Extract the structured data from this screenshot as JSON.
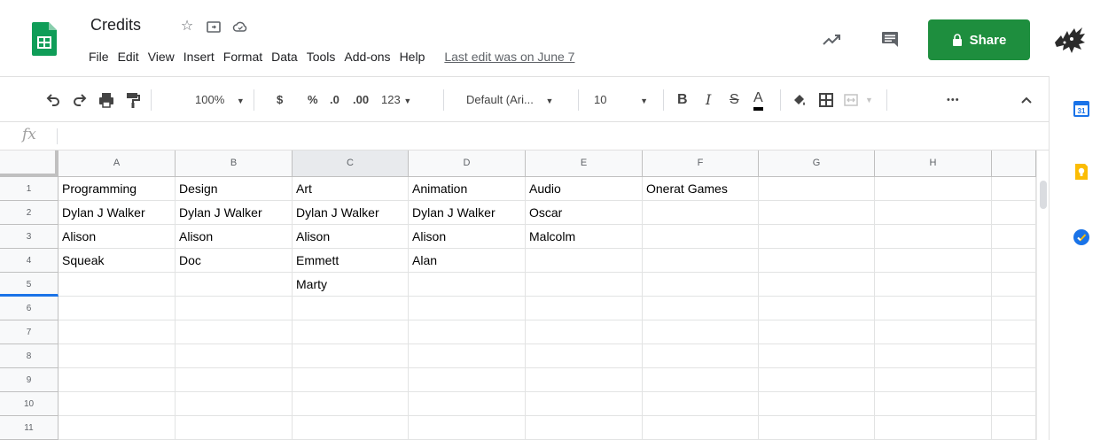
{
  "doc": {
    "title": "Credits",
    "last_edit": "Last edit was on June 7"
  },
  "menu": [
    "File",
    "Edit",
    "View",
    "Insert",
    "Format",
    "Data",
    "Tools",
    "Add-ons",
    "Help"
  ],
  "share": {
    "label": "Share"
  },
  "toolbar": {
    "zoom": "100%",
    "currency": "$",
    "percent": "%",
    "dec_decrease": ".0",
    "dec_increase": ".00",
    "more_formats": "123",
    "font": "Default (Ari...",
    "font_size": "10",
    "bold": "B",
    "italic": "I",
    "strike": "S",
    "text_color": "A",
    "more": "•••"
  },
  "formula": {
    "fx": "fx",
    "value": ""
  },
  "columns": [
    "A",
    "B",
    "C",
    "D",
    "E",
    "F",
    "G",
    "H"
  ],
  "rows": [
    [
      "Programming",
      "Design",
      "Art",
      "Animation",
      "Audio",
      "Onerat Games",
      "",
      ""
    ],
    [
      "Dylan J Walker",
      "Dylan J Walker",
      "Dylan J Walker",
      "Dylan J Walker",
      "Oscar",
      "",
      "",
      ""
    ],
    [
      "Alison",
      "Alison",
      "Alison",
      "Alison",
      "Malcolm",
      "",
      "",
      ""
    ],
    [
      "Squeak",
      "Doc",
      "Emmett",
      "Alan",
      "",
      "",
      "",
      ""
    ],
    [
      "",
      "",
      "Marty",
      "",
      "",
      "",
      "",
      ""
    ],
    [
      "",
      "",
      "",
      "",
      "",
      "",
      "",
      ""
    ],
    [
      "",
      "",
      "",
      "",
      "",
      "",
      "",
      ""
    ],
    [
      "",
      "",
      "",
      "",
      "",
      "",
      "",
      ""
    ],
    [
      "",
      "",
      "",
      "",
      "",
      "",
      "",
      ""
    ],
    [
      "",
      "",
      "",
      "",
      "",
      "",
      "",
      ""
    ],
    [
      "",
      "",
      "",
      "",
      "",
      "",
      "",
      ""
    ]
  ],
  "row_numbers": [
    "1",
    "2",
    "3",
    "4",
    "5",
    "6",
    "7",
    "8",
    "9",
    "10",
    "11"
  ],
  "side_panel": {
    "calendar_day": "31"
  },
  "colors": {
    "share_green": "#1e8e3e",
    "sheets_green": "#0f9d58",
    "selection_blue": "#1a73e8",
    "keep_yellow": "#fbbc04",
    "tasks_blue": "#1a73e8"
  },
  "icons": [
    "sheets-logo-icon",
    "star-icon",
    "move-folder-icon",
    "cloud-status-icon",
    "trend-icon",
    "comment-icon",
    "lock-icon",
    "undo-icon",
    "redo-icon",
    "print-icon",
    "paint-format-icon",
    "dropdown-icon",
    "fill-color-icon",
    "borders-icon",
    "merge-icon",
    "collapse-icon",
    "calendar-icon",
    "keep-icon",
    "tasks-icon"
  ],
  "selection": {
    "active_column": "C",
    "active_row": "5"
  }
}
